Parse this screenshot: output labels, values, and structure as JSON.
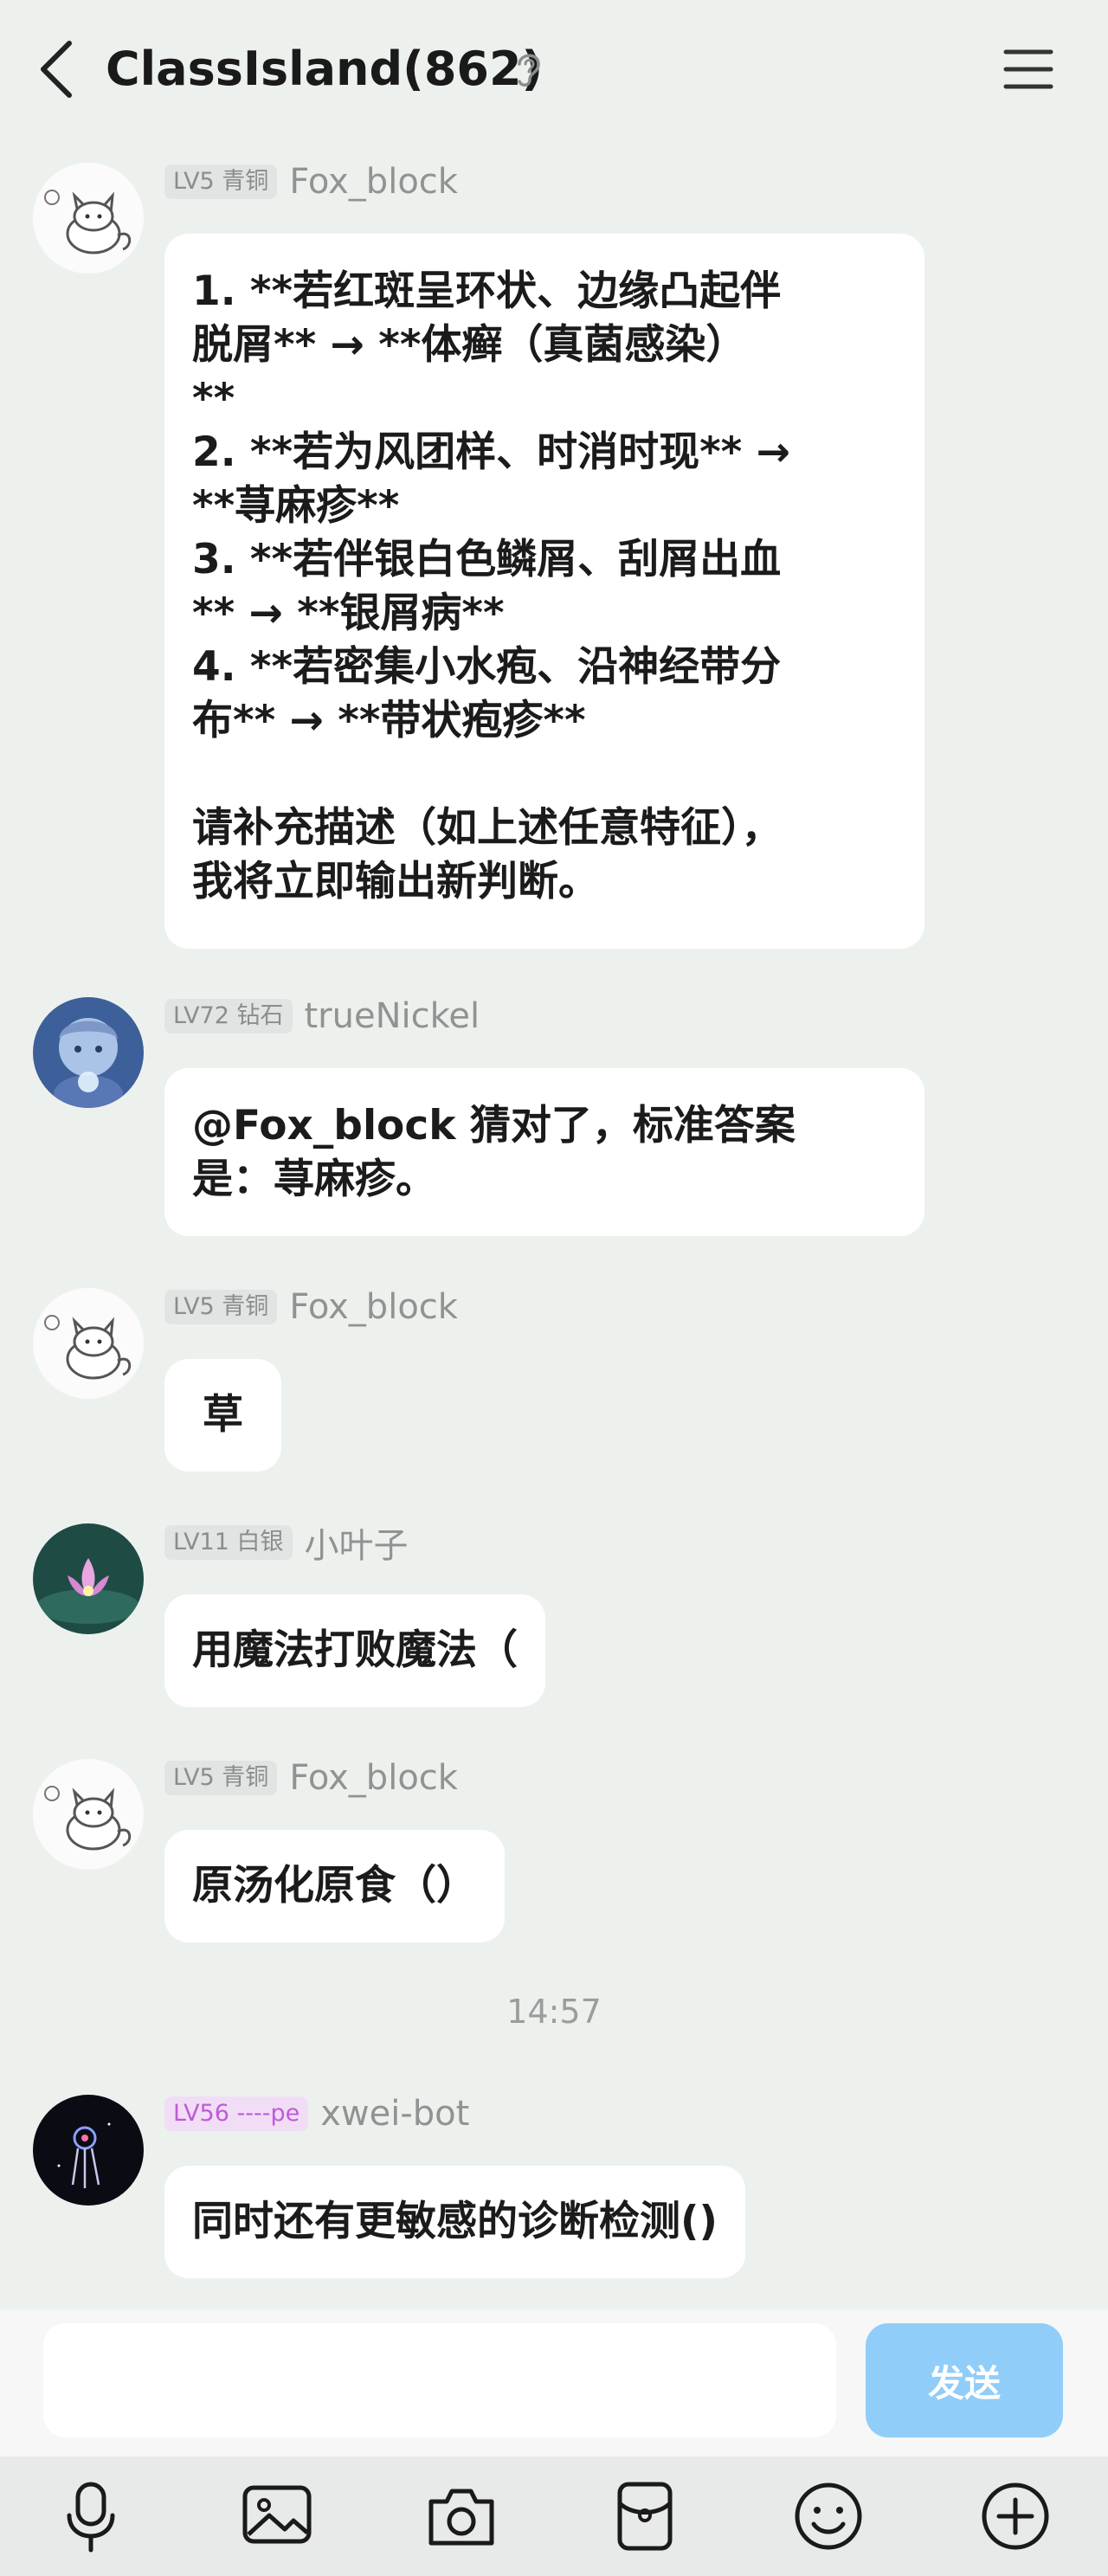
{
  "header": {
    "title": "ClassIsland(862)"
  },
  "messages": [
    {
      "level": "LV5 青铜",
      "name": "Fox_block",
      "lines": [
        "1. **若红斑呈环状、边缘凸起伴",
        "脱屑** → **体癣（真菌感染）",
        "**",
        "2. **若为风团样、时消时现** →",
        "**荨麻疹**",
        "3. **若伴银白色鳞屑、刮屑出血",
        "** → **银屑病**",
        "4. **若密集小水疱、沿神经带分",
        "布** → **带状疱疹**",
        "",
        "请补充描述（如上述任意特征），",
        "我将立即输出新判断。"
      ]
    },
    {
      "level": "LV72 钻石",
      "name": "trueNickel",
      "lines": [
        "@Fox_block 猜对了，标准答案",
        "是：荨麻疹。"
      ]
    },
    {
      "level": "LV5 青铜",
      "name": "Fox_block",
      "lines": [
        "草"
      ]
    },
    {
      "level": "LV11 白银",
      "name": "小叶子",
      "lines": [
        "用魔法打败魔法（"
      ]
    },
    {
      "level": "LV5 青铜",
      "name": "Fox_block",
      "lines": [
        "原汤化原食（）"
      ]
    },
    {
      "level": "LV56 ----pe",
      "name": "xwei-bot",
      "lines": [
        "同时还有更敏感的诊断检测()"
      ]
    }
  ],
  "time_divider": "14:57",
  "input": {
    "send_label": "发送",
    "placeholder": ""
  },
  "colors": {
    "send": "#90CDF9",
    "background": "#EDF1EE",
    "badge_purple": "#C05AD8"
  },
  "toolbar_icons": [
    "microphone-icon",
    "image-icon",
    "camera-icon",
    "red-packet-icon",
    "emoji-icon",
    "plus-icon"
  ]
}
